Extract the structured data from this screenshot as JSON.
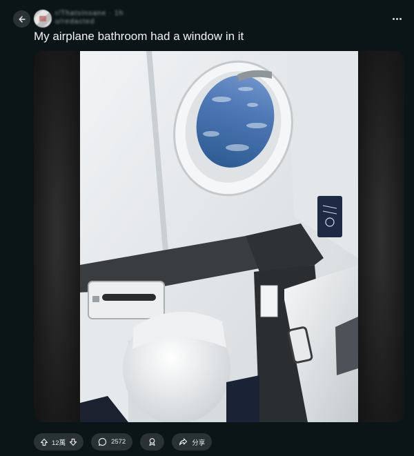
{
  "header": {
    "back_icon": "arrow-left-icon",
    "username": "r/ThatsInsane · 1h",
    "poster": "u/redacted",
    "more_icon": "ellipsis-icon"
  },
  "post": {
    "title": "My airplane bathroom had a window in it"
  },
  "actions": {
    "upvote_icon": "arrow-up-icon",
    "vote_count": "12萬",
    "downvote_icon": "arrow-down-icon",
    "comment_icon": "comment-icon",
    "comment_count": "2572",
    "award_icon": "award-icon",
    "share_icon": "share-icon",
    "share_label": "分享"
  },
  "colors": {
    "background": "#0b1416",
    "pill": "#2a3236",
    "text": "#f2f4f5"
  }
}
